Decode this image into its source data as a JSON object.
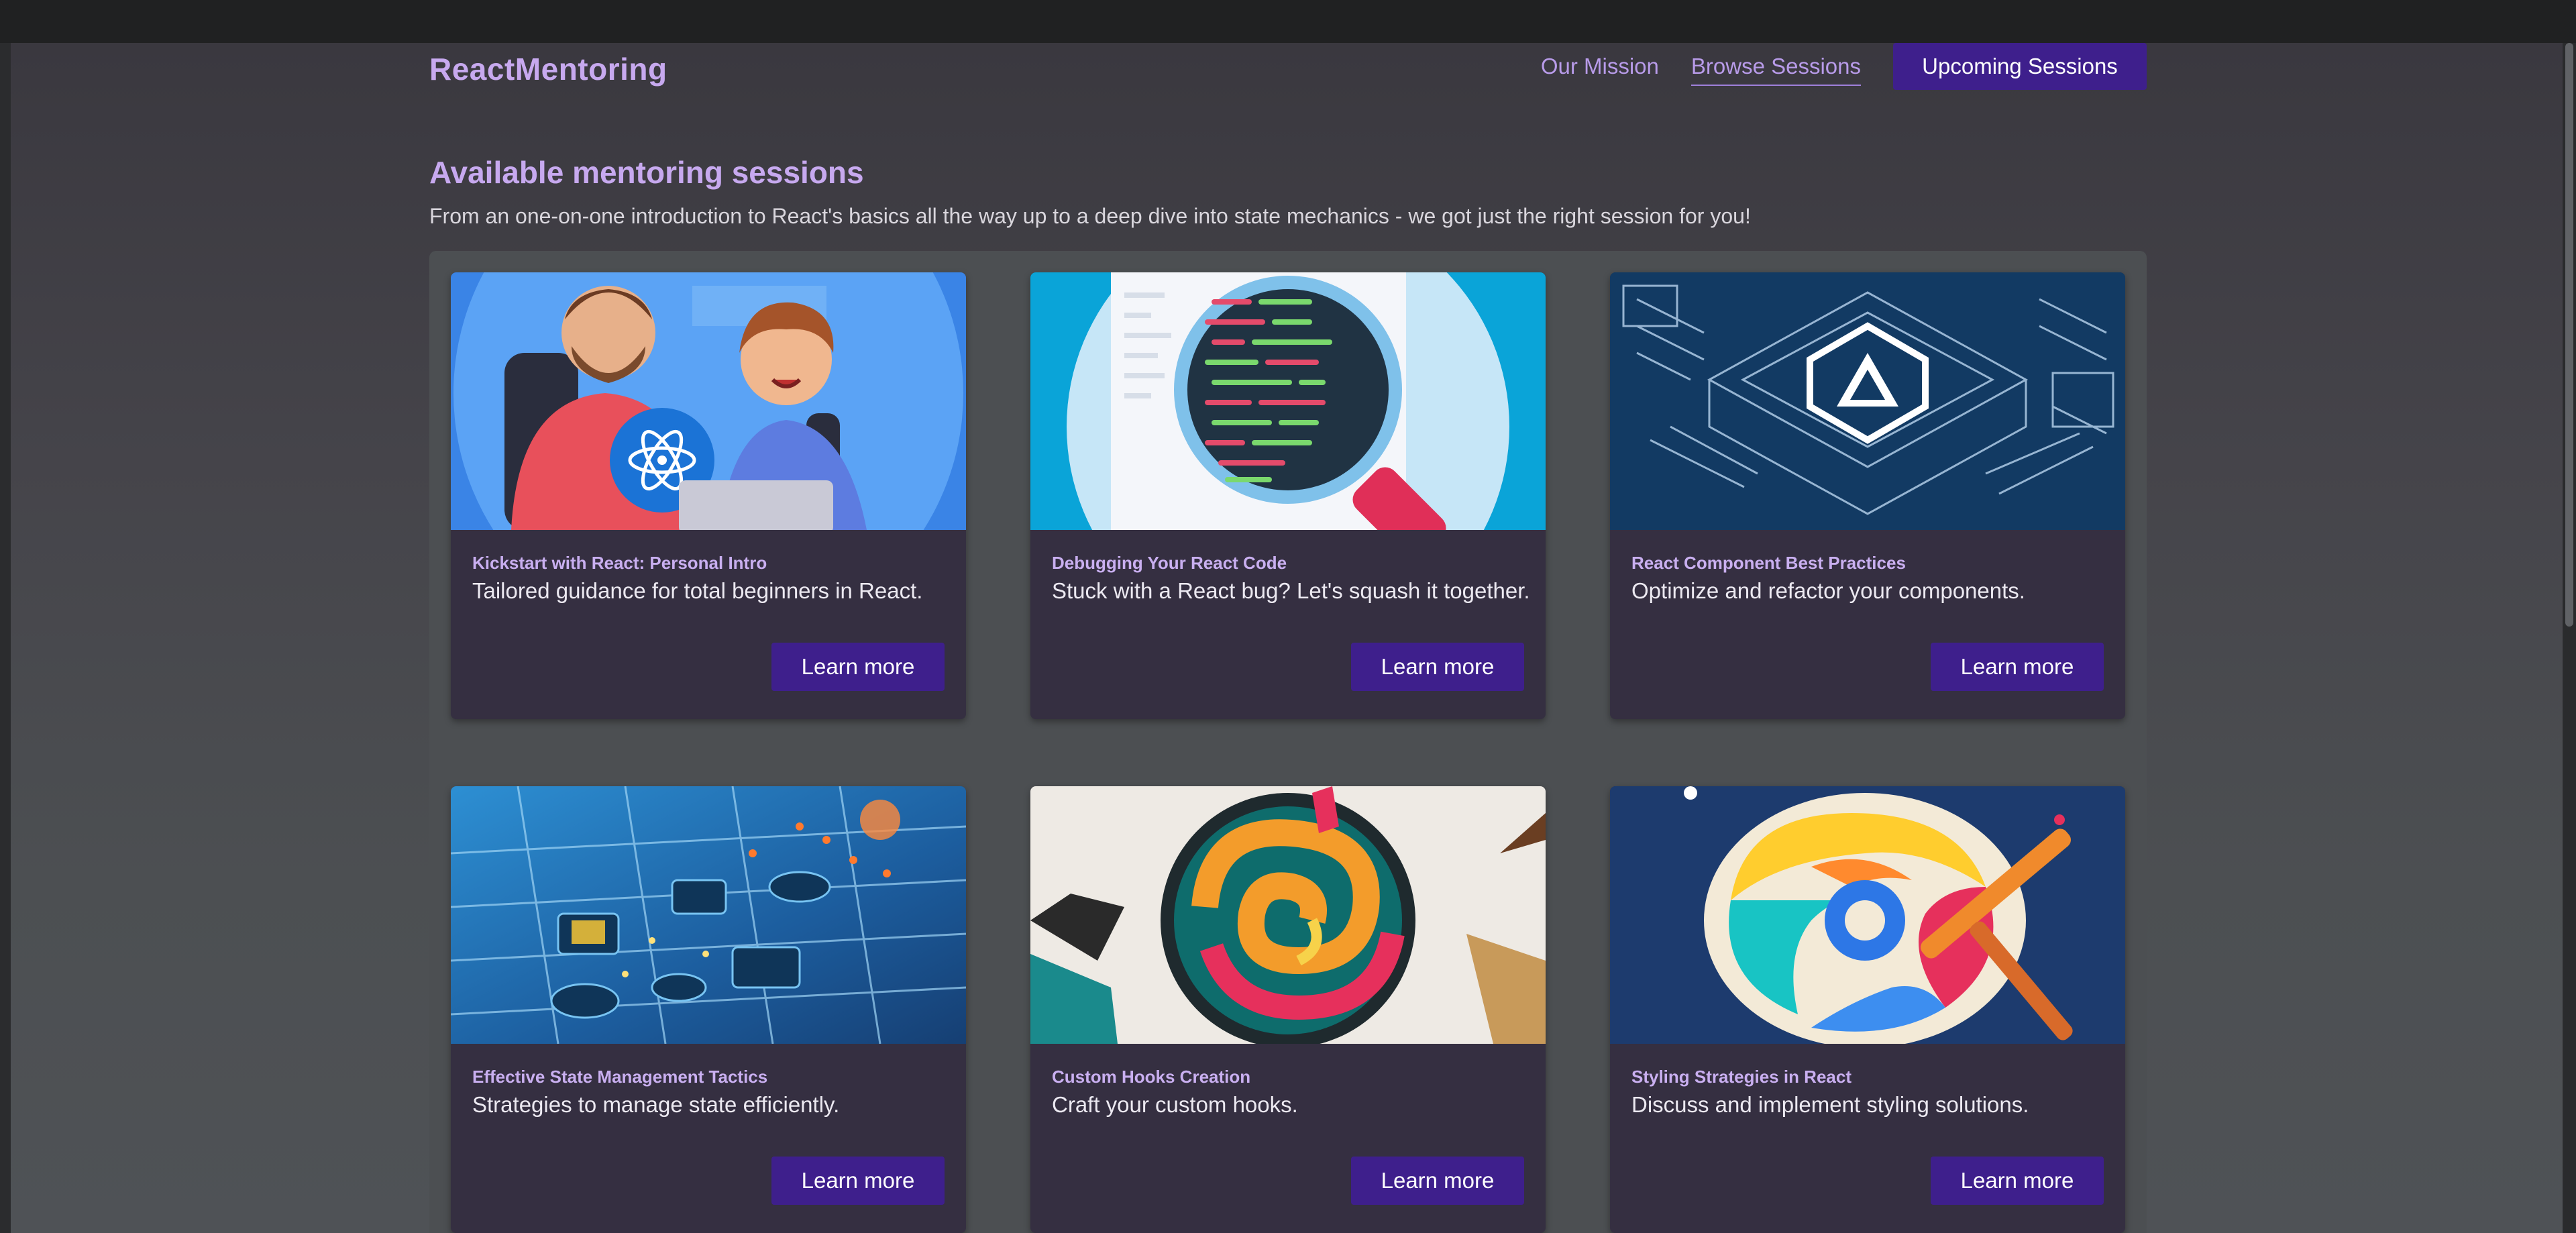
{
  "header": {
    "brand": "ReactMentoring",
    "nav": {
      "our_mission": "Our Mission",
      "browse_sessions": "Browse Sessions",
      "upcoming_sessions": "Upcoming Sessions"
    }
  },
  "main": {
    "title": "Available mentoring sessions",
    "description": "From an one-on-one introduction to React's basics all the way up to a deep dive into state mechanics - we got just the right session for you!",
    "sessions": [
      {
        "title": "Kickstart with React: Personal Intro",
        "summary": "Tailored guidance for total beginners in React.",
        "button": "Learn more",
        "image": "mentor-and-student-illustration"
      },
      {
        "title": "Debugging Your React Code",
        "summary": "Stuck with a React bug? Let's squash it together.",
        "button": "Learn more",
        "image": "magnifying-glass-over-code-illustration"
      },
      {
        "title": "React Component Best Practices",
        "summary": "Optimize and refactor your components.",
        "button": "Learn more",
        "image": "component-blueprint-illustration"
      },
      {
        "title": "Effective State Management Tactics",
        "summary": "Strategies to manage state efficiently.",
        "button": "Learn more",
        "image": "circuit-board-state-illustration"
      },
      {
        "title": "Custom Hooks Creation",
        "summary": "Craft your custom hooks.",
        "button": "Learn more",
        "image": "swirl-hook-logo-illustration"
      },
      {
        "title": "Styling Strategies in React",
        "summary": "Discuss and implement styling solutions.",
        "button": "Learn more",
        "image": "paint-brush-swirl-illustration"
      }
    ]
  },
  "colors": {
    "accent": "#c7a9ef",
    "button": "#3e1f8c",
    "card": "#352f41"
  }
}
